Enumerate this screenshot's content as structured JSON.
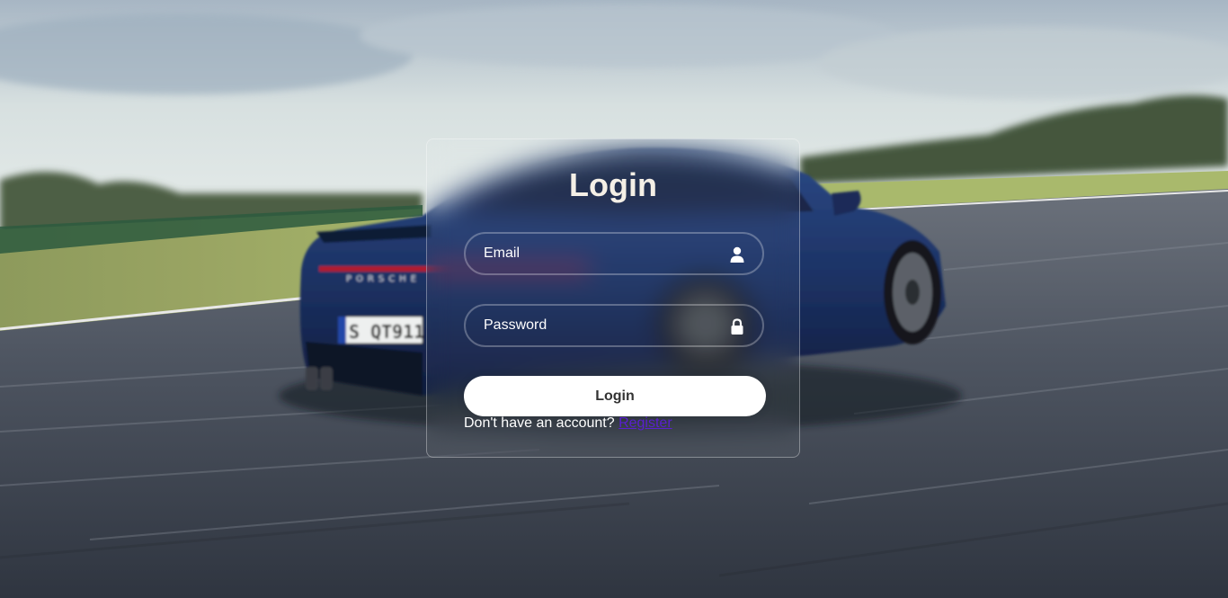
{
  "login": {
    "title": "Login",
    "email_placeholder": "Email",
    "password_placeholder": "Password",
    "submit_label": "Login",
    "prompt_text": "Don't have an account?",
    "register_link": "Register"
  },
  "icons": {
    "email": "user-icon",
    "password": "lock-icon"
  },
  "colors": {
    "title_text": "#f4efe6",
    "register_link": "#5a1fd1",
    "button_bg": "#ffffff",
    "button_text": "#333333"
  }
}
